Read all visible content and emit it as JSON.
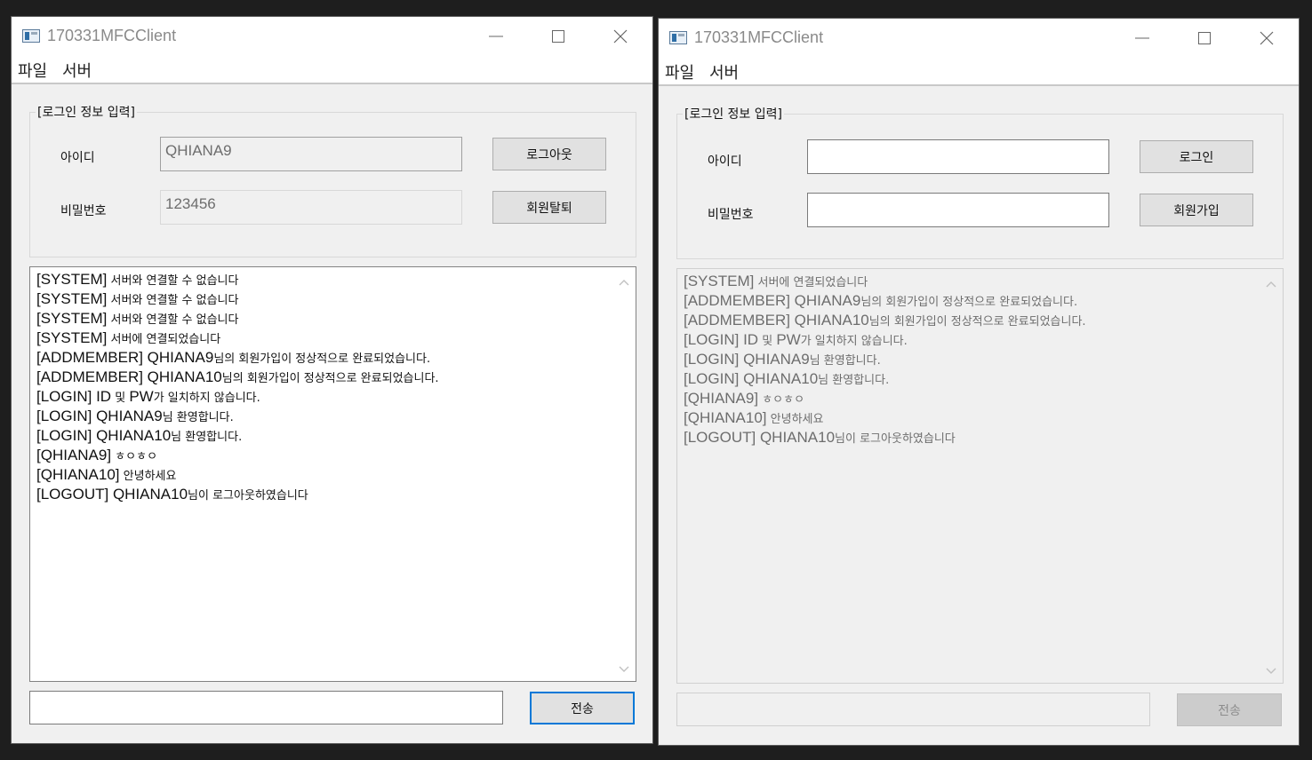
{
  "windows": [
    {
      "title": "170331MFCClient",
      "menu": [
        "파일",
        "서버"
      ],
      "group_label": "[로그인 정보 입력]",
      "id_label": "아이디",
      "pw_label": "비밀번호",
      "id_value": "QHIANA9",
      "pw_value": "123456",
      "btn_top": "로그아웃",
      "btn_bottom": "회원탈퇴",
      "send_label": "전송",
      "message_value": "",
      "log": [
        {
          "tag": "[SYSTEM]",
          "msg": " 서버와 연결할 수 없습니다"
        },
        {
          "tag": "[SYSTEM]",
          "msg": " 서버와 연결할 수 없습니다"
        },
        {
          "tag": "[SYSTEM]",
          "msg": " 서버와 연결할 수 없습니다"
        },
        {
          "tag": "[SYSTEM]",
          "msg": " 서버에 연결되었습니다"
        },
        {
          "tag": "[ADDMEMBER] QHIANA9",
          "msg": "님의 회원가입이 정상적으로 완료되었습니다."
        },
        {
          "tag": "[ADDMEMBER] QHIANA10",
          "msg": "님의 회원가입이 정상적으로 완료되었습니다."
        },
        {
          "tag": "[LOGIN] ID",
          "msg": " 및 ",
          "tag2": "PW",
          "msg2": "가 일치하지 않습니다."
        },
        {
          "tag": "[LOGIN] QHIANA9",
          "msg": "님 환영합니다."
        },
        {
          "tag": "[LOGIN] QHIANA10",
          "msg": "님 환영합니다."
        },
        {
          "tag": "[QHIANA9]",
          "msg": " ㅎㅇㅎㅇ"
        },
        {
          "tag": "[QHIANA10]",
          "msg": " 안녕하세요"
        },
        {
          "tag": "[LOGOUT] QHIANA10",
          "msg": "님이 로그아웃하였습니다"
        }
      ]
    },
    {
      "title": "170331MFCClient",
      "menu": [
        "파일",
        "서버"
      ],
      "group_label": "[로그인 정보 입력]",
      "id_label": "아이디",
      "pw_label": "비밀번호",
      "id_value": "",
      "pw_value": "",
      "btn_top": "로그인",
      "btn_bottom": "회원가입",
      "send_label": "전송",
      "message_value": "",
      "log": [
        {
          "tag": "[SYSTEM]",
          "msg": " 서버에 연결되었습니다"
        },
        {
          "tag": "[ADDMEMBER] QHIANA9",
          "msg": "님의 회원가입이 정상적으로 완료되었습니다."
        },
        {
          "tag": "[ADDMEMBER] QHIANA10",
          "msg": "님의 회원가입이 정상적으로 완료되었습니다."
        },
        {
          "tag": "[LOGIN] ID",
          "msg": " 및 ",
          "tag2": "PW",
          "msg2": "가 일치하지 않습니다."
        },
        {
          "tag": "[LOGIN] QHIANA9",
          "msg": "님 환영합니다."
        },
        {
          "tag": "[LOGIN] QHIANA10",
          "msg": "님 환영합니다."
        },
        {
          "tag": "[QHIANA9]",
          "msg": " ㅎㅇㅎㅇ"
        },
        {
          "tag": "[QHIANA10]",
          "msg": " 안녕하세요"
        },
        {
          "tag": "[LOGOUT] QHIANA10",
          "msg": "님이 로그아웃하였습니다"
        }
      ]
    }
  ]
}
